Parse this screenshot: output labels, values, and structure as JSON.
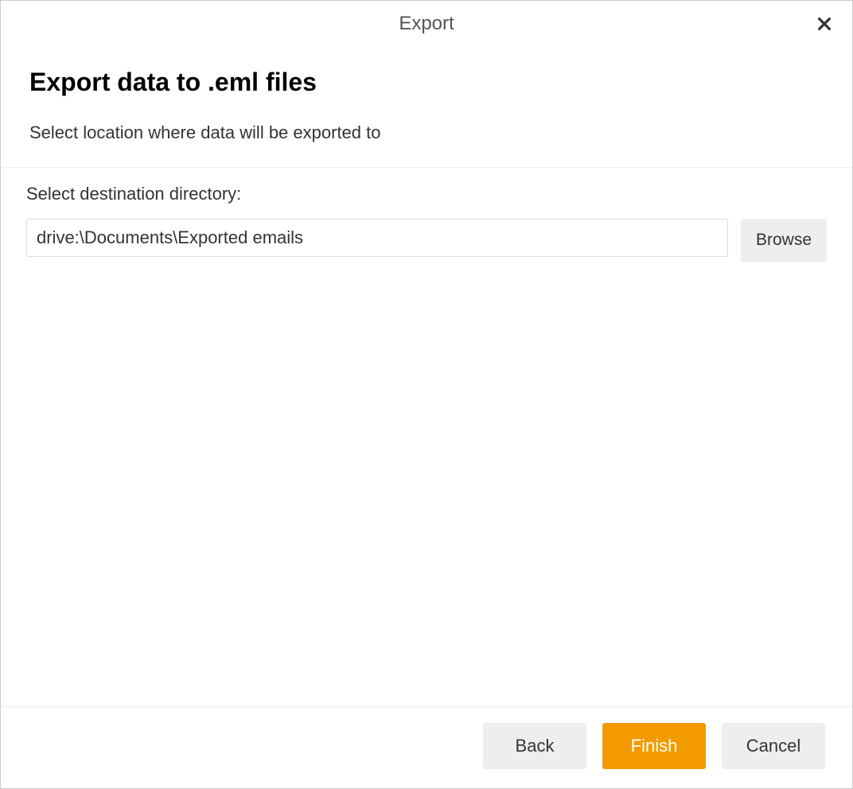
{
  "titlebar": {
    "title": "Export"
  },
  "header": {
    "heading": "Export data to .eml files",
    "subheading": "Select location where data will be exported to"
  },
  "content": {
    "destination_label": "Select destination directory:",
    "path_value": "drive:\\Documents\\Exported emails",
    "browse_label": "Browse"
  },
  "footer": {
    "back_label": "Back",
    "finish_label": "Finish",
    "cancel_label": "Cancel"
  }
}
